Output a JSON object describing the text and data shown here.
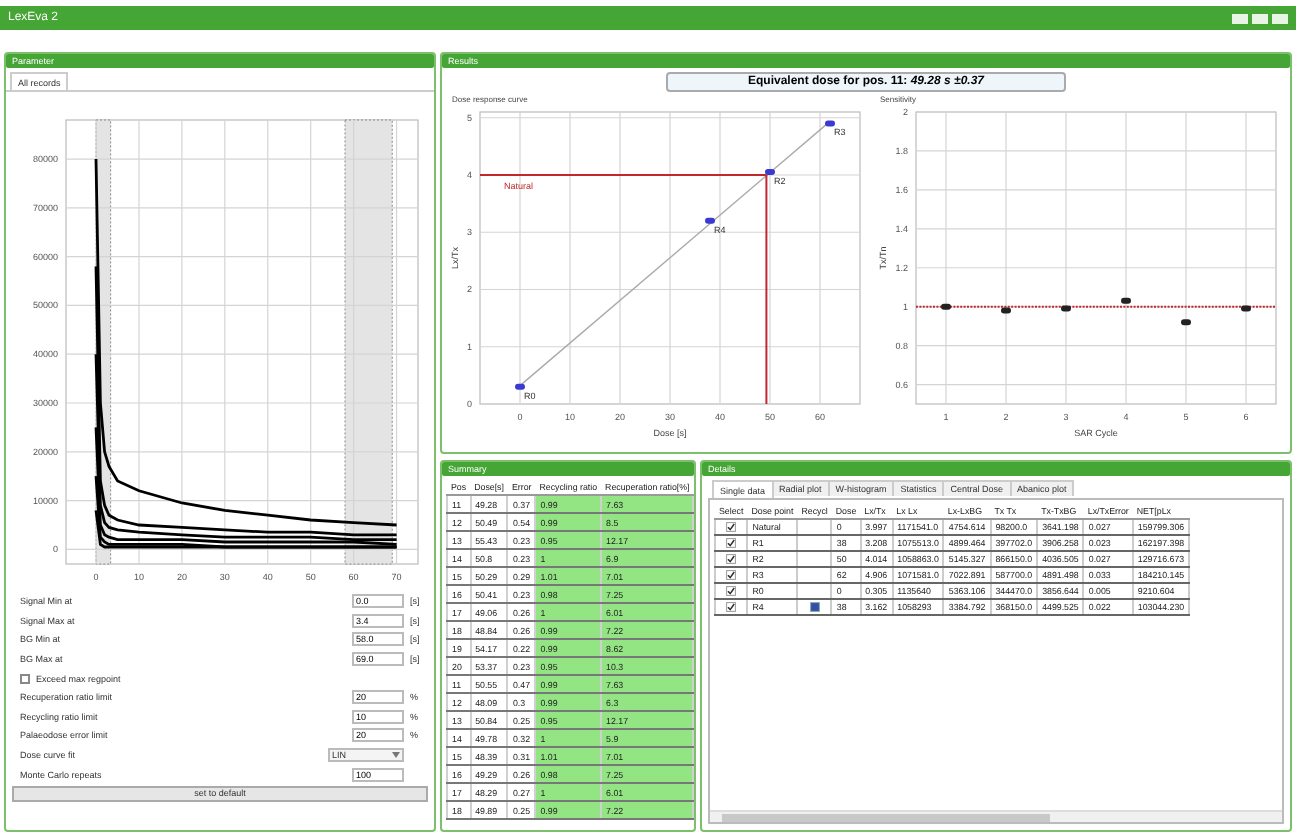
{
  "window": {
    "title": "LexEva 2"
  },
  "parameter": {
    "title": "Parameter",
    "tabs": [
      {
        "label": "All records",
        "selected": true
      }
    ],
    "chart_data": {
      "type": "line",
      "x": [
        0,
        1,
        2,
        3,
        5,
        10,
        20,
        30,
        40,
        50,
        60,
        70
      ],
      "xlim": [
        -7,
        75
      ],
      "ylim": [
        -3000,
        88000
      ],
      "xticks": [
        0,
        10,
        20,
        30,
        40,
        50,
        60,
        70
      ],
      "yticks": [
        0,
        10000,
        20000,
        30000,
        40000,
        50000,
        60000,
        70000,
        80000
      ],
      "grid": true,
      "series": [
        {
          "color": "#000000",
          "values": [
            80000,
            30000,
            20000,
            17000,
            14000,
            12000,
            9500,
            8000,
            7000,
            6000,
            5500,
            5000
          ]
        },
        {
          "color": "#000000",
          "values": [
            58000,
            14000,
            9000,
            7000,
            6000,
            5000,
            4500,
            4000,
            3500,
            3500,
            3000,
            3000
          ]
        },
        {
          "color": "#000000",
          "values": [
            40000,
            9000,
            5500,
            4500,
            4000,
            3500,
            3000,
            2500,
            2500,
            2500,
            2000,
            2000
          ]
        },
        {
          "color": "#000000",
          "values": [
            25000,
            5000,
            3000,
            2500,
            2000,
            2000,
            2000,
            1500,
            1500,
            1500,
            1500,
            1000
          ]
        },
        {
          "color": "#000000",
          "values": [
            15000,
            2500,
            1500,
            1000,
            1000,
            1000,
            1000,
            500,
            500,
            500,
            500,
            500
          ]
        },
        {
          "color": "#000000",
          "values": [
            8000,
            1000,
            500,
            500,
            500,
            500,
            500,
            500,
            500,
            500,
            500,
            500
          ]
        }
      ],
      "bands": [
        {
          "axis": "x",
          "from": 0,
          "to": 3.4
        },
        {
          "axis": "x",
          "from": 58,
          "to": 69
        }
      ]
    },
    "fields": [
      {
        "kind": "number",
        "label": "Signal Min at",
        "value": "0.0",
        "unit": "[s]"
      },
      {
        "kind": "number",
        "label": "Signal Max at",
        "value": "3.4",
        "unit": "[s]"
      },
      {
        "kind": "number",
        "label": "BG Min at",
        "value": "58.0",
        "unit": "[s]"
      },
      {
        "kind": "number",
        "label": "BG Max at",
        "value": "69.0",
        "unit": "[s]"
      },
      {
        "kind": "checkbox",
        "label": "Exceed max regpoint",
        "checked": false
      },
      {
        "kind": "number",
        "label": "Recuperation ratio limit",
        "value": "20",
        "unit": "%"
      },
      {
        "kind": "number",
        "label": "Recycling ratio limit",
        "value": "10",
        "unit": "%"
      },
      {
        "kind": "number",
        "label": "Palaeodose error limit",
        "value": "20",
        "unit": "%"
      },
      {
        "kind": "select",
        "label": "Dose curve fit",
        "value": "LIN"
      },
      {
        "kind": "number",
        "label": "Monte Carlo repeats",
        "value": "100"
      }
    ],
    "button": "set to default"
  },
  "results": {
    "title": "Results",
    "equivalent_dose": "Equivalent dose for pos. 11: *49.28 s ±0.37*",
    "dose_response": {
      "title": "Dose response curve",
      "chart_data": {
        "type": "scatter",
        "xlabel": "Dose [s]",
        "ylabel": "Lx/Tx",
        "x": [
          0,
          38,
          50,
          62
        ],
        "xlim": [
          -8,
          68
        ],
        "ylim": [
          0,
          5.1
        ],
        "xticks": [
          0,
          10,
          20,
          30,
          40,
          50,
          60
        ],
        "yticks": [
          0,
          1,
          2,
          3,
          4,
          5
        ],
        "grid": true,
        "series": [
          {
            "color": "#3a3ad0",
            "values": [
              0.3,
              3.2,
              4.05,
              4.9
            ]
          }
        ],
        "ref_lines": [
          {
            "axis": "y",
            "value": 4,
            "label": "Natural",
            "color": "#c0282d"
          },
          {
            "axis": "x",
            "value": 49.28,
            "color": "#c0282d"
          }
        ],
        "annotations": [
          {
            "text": "R0",
            "x": 0,
            "y": 0.3
          },
          {
            "text": "R4",
            "x": 38,
            "y": 3.2
          },
          {
            "text": "R2",
            "x": 50,
            "y": 4.05
          },
          {
            "text": "R3",
            "x": 62,
            "y": 4.9
          }
        ]
      }
    },
    "sensitivity": {
      "title": "Sensitivity",
      "chart_data": {
        "type": "scatter",
        "xlabel": "SAR Cycle",
        "ylabel": "Tx/Tn",
        "x": [
          1,
          2,
          3,
          4,
          5,
          6
        ],
        "xlim": [
          0.5,
          6.5
        ],
        "ylim": [
          0.5,
          2
        ],
        "xticks": [
          1,
          2,
          3,
          4,
          5,
          6
        ],
        "yticks": [
          0.6,
          0.8,
          1,
          1.2,
          1.4,
          1.6,
          1.8,
          2
        ],
        "grid": true,
        "series": [
          {
            "color": "#222222",
            "values": [
              1,
              0.98,
              0.99,
              1.03,
              0.92,
              0.99
            ]
          }
        ],
        "ref_lines": [
          {
            "axis": "y",
            "value": 1,
            "color": "#c0282d"
          }
        ]
      }
    }
  },
  "summary": {
    "title": "Summary",
    "columns": [
      "Pos",
      "Dose[s]",
      "Error",
      "Recycling ratio",
      "Recuperation ratio[%]"
    ],
    "rows": [
      [
        "11",
        "49.28",
        "0.37",
        "0.99",
        "7.63"
      ],
      [
        "12",
        "50.49",
        "0.54",
        "0.99",
        "8.5"
      ],
      [
        "13",
        "55.43",
        "0.23",
        "0.95",
        "12.17"
      ],
      [
        "14",
        "50.8",
        "0.23",
        "1",
        "6.9"
      ],
      [
        "15",
        "50.29",
        "0.29",
        "1.01",
        "7.01"
      ],
      [
        "16",
        "50.41",
        "0.23",
        "0.98",
        "7.25"
      ],
      [
        "17",
        "49.06",
        "0.26",
        "1",
        "6.01"
      ],
      [
        "18",
        "48.84",
        "0.26",
        "0.99",
        "7.22"
      ],
      [
        "19",
        "54.17",
        "0.22",
        "0.99",
        "8.62"
      ],
      [
        "20",
        "53.37",
        "0.23",
        "0.95",
        "10.3"
      ],
      [
        "11",
        "50.55",
        "0.47",
        "0.99",
        "7.63"
      ],
      [
        "12",
        "48.09",
        "0.3",
        "0.99",
        "6.3"
      ],
      [
        "13",
        "50.84",
        "0.25",
        "0.95",
        "12.17"
      ],
      [
        "14",
        "49.78",
        "0.32",
        "1",
        "5.9"
      ],
      [
        "15",
        "48.39",
        "0.31",
        "1.01",
        "7.01"
      ],
      [
        "16",
        "49.29",
        "0.26",
        "0.98",
        "7.25"
      ],
      [
        "17",
        "48.29",
        "0.27",
        "1",
        "6.01"
      ],
      [
        "18",
        "49.89",
        "0.25",
        "0.99",
        "7.22"
      ]
    ]
  },
  "details": {
    "title": "Details",
    "tabs": [
      {
        "label": "Single data",
        "selected": true
      },
      {
        "label": "Radial plot",
        "selected": false
      },
      {
        "label": "W-histogram",
        "selected": false
      },
      {
        "label": "Statistics",
        "selected": false
      },
      {
        "label": "Central Dose",
        "selected": false
      },
      {
        "label": "Abanico plot",
        "selected": false
      }
    ],
    "columns": [
      "Select",
      "Dose point",
      "Recycl",
      "Dose",
      "Lx/Tx",
      "Lx Lx",
      "Lx-LxBG",
      "Tx Tx",
      "Tx-TxBG",
      "Lx/TxError",
      "NET[pLx"
    ],
    "rows": [
      {
        "selected": true,
        "recycled": false,
        "cells": [
          "",
          "Natural",
          "",
          "0",
          "3.997",
          "1171541.0",
          "4754.614",
          "98200.0",
          "3641.198",
          "0.027",
          "159799.306"
        ]
      },
      {
        "selected": true,
        "recycled": false,
        "cells": [
          "",
          "R1",
          "",
          "38",
          "3.208",
          "1075513.0",
          "4899.464",
          "397702.0",
          "3906.258",
          "0.023",
          "162197.398"
        ]
      },
      {
        "selected": true,
        "recycled": false,
        "cells": [
          "",
          "R2",
          "",
          "50",
          "4.014",
          "1058863.0",
          "5145.327",
          "866150.0",
          "4036.505",
          "0.027",
          "129716.673"
        ]
      },
      {
        "selected": true,
        "recycled": false,
        "cells": [
          "",
          "R3",
          "",
          "62",
          "4.906",
          "1071581.0",
          "7022.891",
          "587700.0",
          "4891.498",
          "0.033",
          "184210.145"
        ]
      },
      {
        "selected": true,
        "recycled": false,
        "cells": [
          "",
          "R0",
          "",
          "0",
          "0.305",
          "1135640",
          "5363.106",
          "344470.0",
          "3856.644",
          "0.005",
          "9210.604"
        ]
      },
      {
        "selected": true,
        "recycled": true,
        "cells": [
          "",
          "R4",
          "",
          "38",
          "3.162",
          "1058293",
          "3384.792",
          "368150.0",
          "4499.525",
          "0.022",
          "103044.230"
        ]
      }
    ]
  }
}
